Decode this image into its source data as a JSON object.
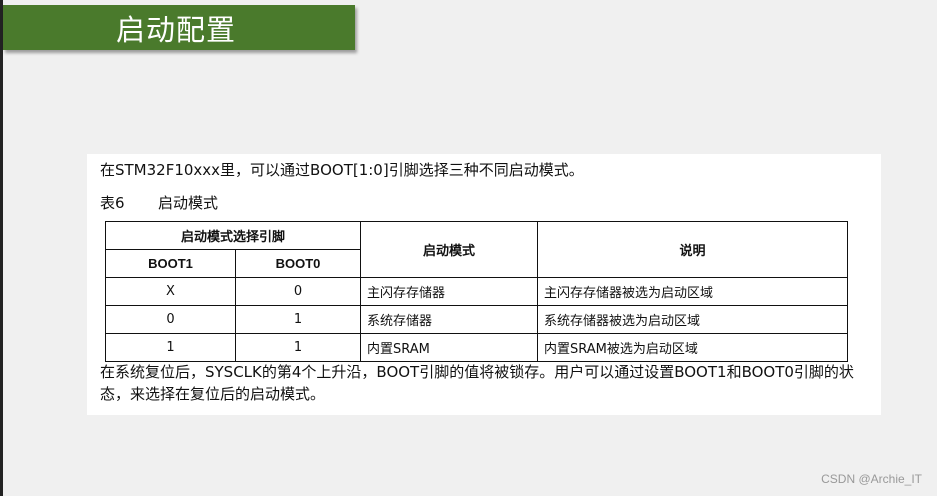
{
  "title": "启动配置",
  "intro": "在STM32F10xxx里，可以通过BOOT[1:0]引脚选择三种不同启动模式。",
  "table_caption": {
    "number": "表6",
    "name": "启动模式"
  },
  "table": {
    "header_group": "启动模式选择引脚",
    "col_boot1": "BOOT1",
    "col_boot0": "BOOT0",
    "col_mode": "启动模式",
    "col_desc": "说明",
    "rows": [
      {
        "boot1": "X",
        "boot0": "0",
        "mode": "主闪存存储器",
        "desc": "主闪存存储器被选为启动区域"
      },
      {
        "boot1": "0",
        "boot0": "1",
        "mode": "系统存储器",
        "desc": "系统存储器被选为启动区域"
      },
      {
        "boot1": "1",
        "boot0": "1",
        "mode": "内置SRAM",
        "desc": "内置SRAM被选为启动区域"
      }
    ]
  },
  "footer": "在系统复位后，SYSCLK的第4个上升沿，BOOT引脚的值将被锁存。用户可以通过设置BOOT1和BOOT0引脚的状态，来选择在复位后的启动模式。",
  "watermark": "CSDN @Archie_IT"
}
